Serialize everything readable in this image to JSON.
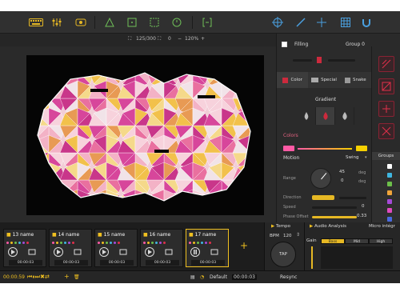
{
  "toolbar": {
    "icons": [
      "keyboard-icon",
      "mixer-icon",
      "midi-icon",
      "triangle-icon",
      "select-icon",
      "group-icon",
      "timer-icon",
      "bracket-icon",
      "target-icon",
      "brush-icon",
      "crosshair-icon",
      "grid-icon",
      "magnet-icon"
    ]
  },
  "subbar": {
    "counter": "125/300",
    "offset": "0",
    "zoom": "120%"
  },
  "panel": {
    "filling_label": "Filling",
    "group_label": "Group 0",
    "tabs": [
      {
        "label": "Color",
        "icon": "color-tab-icon"
      },
      {
        "label": "Special",
        "icon": "special-tab-icon"
      },
      {
        "label": "Snake",
        "icon": "snake-tab-icon"
      }
    ],
    "gradient_title": "Gradient",
    "colors_title": "Colors",
    "motion_label": "Motion",
    "motion_mode": "Swing",
    "range_label": "Range",
    "range_value1": "45",
    "range_value2": "0",
    "unit_deg": "deg",
    "direction_label": "Direction",
    "speed_label": "Speed",
    "speed_value": "0",
    "phase_label": "Phase Offset",
    "phase_value": "0.33",
    "colors": {
      "start": "#ff5aa5",
      "end": "#f5d000"
    }
  },
  "groups": {
    "title": "Groups",
    "items": [
      {
        "color": "#ffffff"
      },
      {
        "color": "#3fb6e0"
      },
      {
        "color": "#6cc04a"
      },
      {
        "color": "#f0a53a"
      },
      {
        "color": "#a64ad8"
      },
      {
        "color": "#e04ac0"
      },
      {
        "color": "#4a6ae0"
      }
    ]
  },
  "clips": [
    {
      "title": "13 name",
      "time": "00:00:03"
    },
    {
      "title": "14 name",
      "time": "00:00:03"
    },
    {
      "title": "15 name",
      "time": "00:00:03"
    },
    {
      "title": "16 name",
      "time": "00:00:03"
    },
    {
      "title": "17 name",
      "time": "00:00:03"
    }
  ],
  "bottombar": {
    "elapsed": "00:00:59",
    "preset": "Default",
    "duration": "00:00:03"
  },
  "tempo": {
    "title": "Tempo",
    "bpm_label": "BPM",
    "bpm_value": "120",
    "tap_label": "TAP",
    "resync_label": "Resync"
  },
  "audio": {
    "title": "Audio Analysis",
    "source": "Micro intégr",
    "gain_label": "Gain",
    "bands": [
      "Bass",
      "Mid",
      "High"
    ]
  }
}
